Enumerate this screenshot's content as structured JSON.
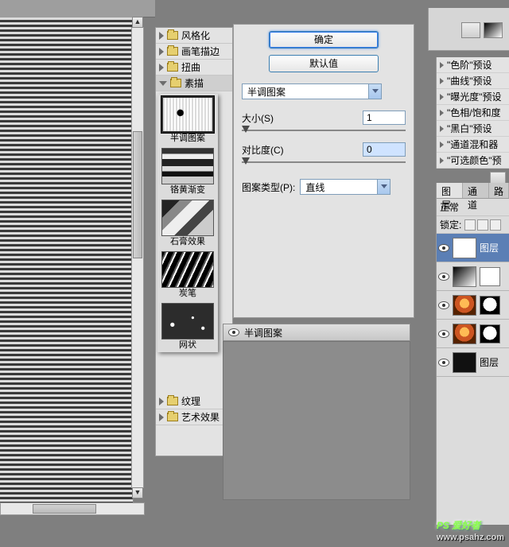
{
  "canvas_top_color": "#9e9e9e",
  "tree": {
    "items": [
      {
        "label": "风格化",
        "open": false
      },
      {
        "label": "画笔描边",
        "open": false
      },
      {
        "label": "扭曲",
        "open": false
      },
      {
        "label": "素描",
        "open": true
      },
      {
        "label": "纹理",
        "open": false
      },
      {
        "label": "艺术效果",
        "open": false
      }
    ]
  },
  "thumbs": [
    {
      "label": "半调图案",
      "cls": "halftone",
      "selected": true
    },
    {
      "label": "铬黄渐变",
      "cls": "chrome"
    },
    {
      "label": "石膏效果",
      "cls": "plaster"
    },
    {
      "label": "炭笔",
      "cls": "charcoal"
    },
    {
      "label": "网状",
      "cls": "reticulation"
    }
  ],
  "settings": {
    "ok": "确定",
    "default": "默认值",
    "filter_combo": "半调图案",
    "size_label": "大小(S)",
    "size_value": "1",
    "contrast_label": "对比度(C)",
    "contrast_value": "0",
    "type_label": "图案类型(P):",
    "type_value": "直线"
  },
  "preview_bar_label": "半调图案",
  "presets": [
    "\"色阶\"预设",
    "\"曲线\"预设",
    "\"曝光度\"预设",
    "\"色相/饱和度",
    "\"黑白\"预设",
    "\"通道混和器",
    "\"可选颜色\"预"
  ],
  "layers": {
    "tabs": [
      "图层",
      "通道",
      "路"
    ],
    "blend": "正常",
    "lock_label": "锁定:",
    "items": [
      {
        "name": "图层",
        "thumb": "white",
        "selected": true
      },
      {
        "name": "",
        "thumb": "gradient",
        "mask": true
      },
      {
        "name": "",
        "thumb": "photo",
        "mask": "shape"
      },
      {
        "name": "",
        "thumb": "photo",
        "mask": "shape"
      },
      {
        "name": "图层",
        "thumb": "black"
      }
    ]
  },
  "watermark": {
    "logo": "PS 爱好者",
    "url": "www.psahz.com"
  }
}
